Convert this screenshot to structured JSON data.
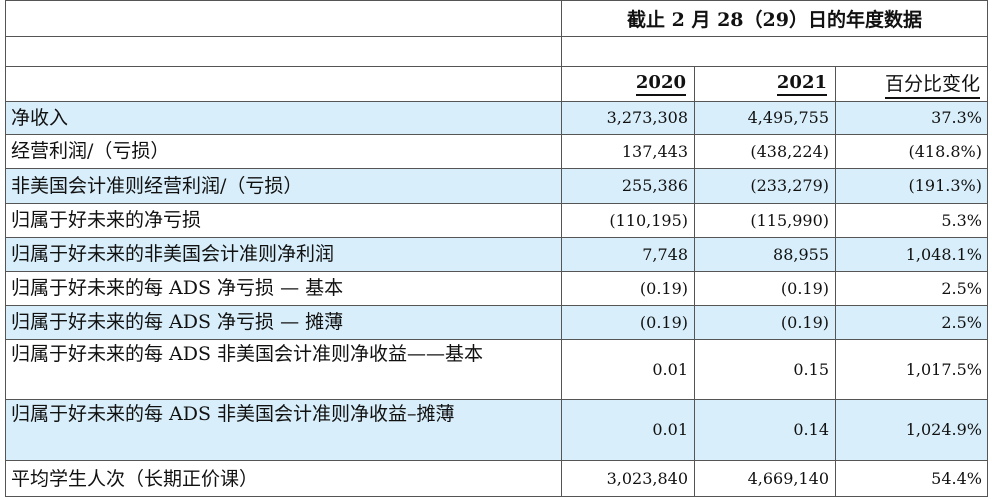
{
  "header": {
    "title": "截止 2 月 28（29）日的年度数据",
    "col_2020": "2020",
    "col_2021": "2021",
    "col_change": "百分比变化"
  },
  "rows": [
    {
      "label": "净收入",
      "v2020": "3,273,308",
      "v2021": "4,495,755",
      "change": "37.3%",
      "highlight": true
    },
    {
      "label": "经营利润/（亏损）",
      "v2020": "137,443",
      "v2021": "(438,224)",
      "change": "(418.8%)",
      "highlight": false
    },
    {
      "label": "非美国会计准则经营利润/（亏损）",
      "v2020": "255,386",
      "v2021": "(233,279)",
      "change": "(191.3%)",
      "highlight": true
    },
    {
      "label": "归属于好未来的净亏损",
      "v2020": "(110,195)",
      "v2021": "(115,990)",
      "change": "5.3%",
      "highlight": false
    },
    {
      "label": "归属于好未来的非美国会计准则净利润",
      "v2020": "7,748",
      "v2021": "88,955",
      "change": "1,048.1%",
      "highlight": true
    },
    {
      "label": "归属于好未来的每 ADS 净亏损 — 基本",
      "v2020": "(0.19)",
      "v2021": "(0.19)",
      "change": "2.5%",
      "highlight": false
    },
    {
      "label": "归属于好未来的每 ADS 净亏损 — 摊薄",
      "v2020": "(0.19)",
      "v2021": "(0.19)",
      "change": "2.5%",
      "highlight": true
    },
    {
      "label": "归属于好未来的每 ADS 非美国会计准则净收益——基本",
      "v2020": "0.01",
      "v2021": "0.15",
      "change": "1,017.5%",
      "highlight": false
    },
    {
      "label": "归属于好未来的每 ADS 非美国会计准则净收益–摊薄",
      "v2020": "0.01",
      "v2021": "0.14",
      "change": "1,024.9%",
      "highlight": true
    },
    {
      "label": "平均学生人次（长期正价课）",
      "v2020": "3,023,840",
      "v2021": "4,669,140",
      "change": "54.4%",
      "highlight": false
    }
  ]
}
